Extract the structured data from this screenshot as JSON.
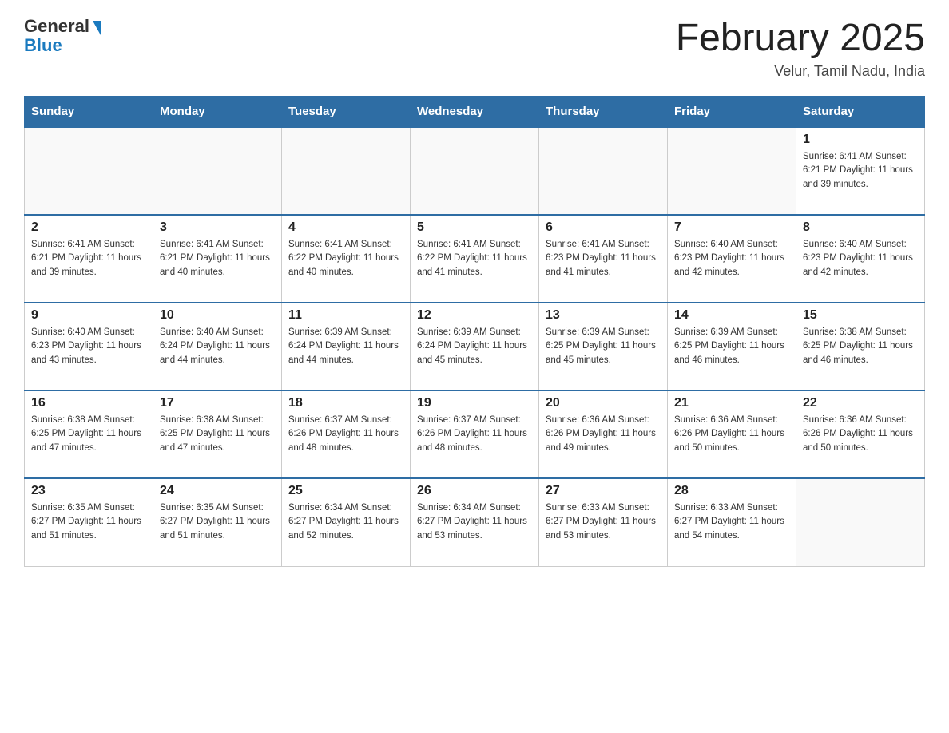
{
  "header": {
    "logo_general": "General",
    "logo_blue": "Blue",
    "month_title": "February 2025",
    "location": "Velur, Tamil Nadu, India"
  },
  "days_of_week": [
    "Sunday",
    "Monday",
    "Tuesday",
    "Wednesday",
    "Thursday",
    "Friday",
    "Saturday"
  ],
  "weeks": [
    [
      {
        "day": "",
        "info": ""
      },
      {
        "day": "",
        "info": ""
      },
      {
        "day": "",
        "info": ""
      },
      {
        "day": "",
        "info": ""
      },
      {
        "day": "",
        "info": ""
      },
      {
        "day": "",
        "info": ""
      },
      {
        "day": "1",
        "info": "Sunrise: 6:41 AM\nSunset: 6:21 PM\nDaylight: 11 hours\nand 39 minutes."
      }
    ],
    [
      {
        "day": "2",
        "info": "Sunrise: 6:41 AM\nSunset: 6:21 PM\nDaylight: 11 hours\nand 39 minutes."
      },
      {
        "day": "3",
        "info": "Sunrise: 6:41 AM\nSunset: 6:21 PM\nDaylight: 11 hours\nand 40 minutes."
      },
      {
        "day": "4",
        "info": "Sunrise: 6:41 AM\nSunset: 6:22 PM\nDaylight: 11 hours\nand 40 minutes."
      },
      {
        "day": "5",
        "info": "Sunrise: 6:41 AM\nSunset: 6:22 PM\nDaylight: 11 hours\nand 41 minutes."
      },
      {
        "day": "6",
        "info": "Sunrise: 6:41 AM\nSunset: 6:23 PM\nDaylight: 11 hours\nand 41 minutes."
      },
      {
        "day": "7",
        "info": "Sunrise: 6:40 AM\nSunset: 6:23 PM\nDaylight: 11 hours\nand 42 minutes."
      },
      {
        "day": "8",
        "info": "Sunrise: 6:40 AM\nSunset: 6:23 PM\nDaylight: 11 hours\nand 42 minutes."
      }
    ],
    [
      {
        "day": "9",
        "info": "Sunrise: 6:40 AM\nSunset: 6:23 PM\nDaylight: 11 hours\nand 43 minutes."
      },
      {
        "day": "10",
        "info": "Sunrise: 6:40 AM\nSunset: 6:24 PM\nDaylight: 11 hours\nand 44 minutes."
      },
      {
        "day": "11",
        "info": "Sunrise: 6:39 AM\nSunset: 6:24 PM\nDaylight: 11 hours\nand 44 minutes."
      },
      {
        "day": "12",
        "info": "Sunrise: 6:39 AM\nSunset: 6:24 PM\nDaylight: 11 hours\nand 45 minutes."
      },
      {
        "day": "13",
        "info": "Sunrise: 6:39 AM\nSunset: 6:25 PM\nDaylight: 11 hours\nand 45 minutes."
      },
      {
        "day": "14",
        "info": "Sunrise: 6:39 AM\nSunset: 6:25 PM\nDaylight: 11 hours\nand 46 minutes."
      },
      {
        "day": "15",
        "info": "Sunrise: 6:38 AM\nSunset: 6:25 PM\nDaylight: 11 hours\nand 46 minutes."
      }
    ],
    [
      {
        "day": "16",
        "info": "Sunrise: 6:38 AM\nSunset: 6:25 PM\nDaylight: 11 hours\nand 47 minutes."
      },
      {
        "day": "17",
        "info": "Sunrise: 6:38 AM\nSunset: 6:25 PM\nDaylight: 11 hours\nand 47 minutes."
      },
      {
        "day": "18",
        "info": "Sunrise: 6:37 AM\nSunset: 6:26 PM\nDaylight: 11 hours\nand 48 minutes."
      },
      {
        "day": "19",
        "info": "Sunrise: 6:37 AM\nSunset: 6:26 PM\nDaylight: 11 hours\nand 48 minutes."
      },
      {
        "day": "20",
        "info": "Sunrise: 6:36 AM\nSunset: 6:26 PM\nDaylight: 11 hours\nand 49 minutes."
      },
      {
        "day": "21",
        "info": "Sunrise: 6:36 AM\nSunset: 6:26 PM\nDaylight: 11 hours\nand 50 minutes."
      },
      {
        "day": "22",
        "info": "Sunrise: 6:36 AM\nSunset: 6:26 PM\nDaylight: 11 hours\nand 50 minutes."
      }
    ],
    [
      {
        "day": "23",
        "info": "Sunrise: 6:35 AM\nSunset: 6:27 PM\nDaylight: 11 hours\nand 51 minutes."
      },
      {
        "day": "24",
        "info": "Sunrise: 6:35 AM\nSunset: 6:27 PM\nDaylight: 11 hours\nand 51 minutes."
      },
      {
        "day": "25",
        "info": "Sunrise: 6:34 AM\nSunset: 6:27 PM\nDaylight: 11 hours\nand 52 minutes."
      },
      {
        "day": "26",
        "info": "Sunrise: 6:34 AM\nSunset: 6:27 PM\nDaylight: 11 hours\nand 53 minutes."
      },
      {
        "day": "27",
        "info": "Sunrise: 6:33 AM\nSunset: 6:27 PM\nDaylight: 11 hours\nand 53 minutes."
      },
      {
        "day": "28",
        "info": "Sunrise: 6:33 AM\nSunset: 6:27 PM\nDaylight: 11 hours\nand 54 minutes."
      },
      {
        "day": "",
        "info": ""
      }
    ]
  ]
}
